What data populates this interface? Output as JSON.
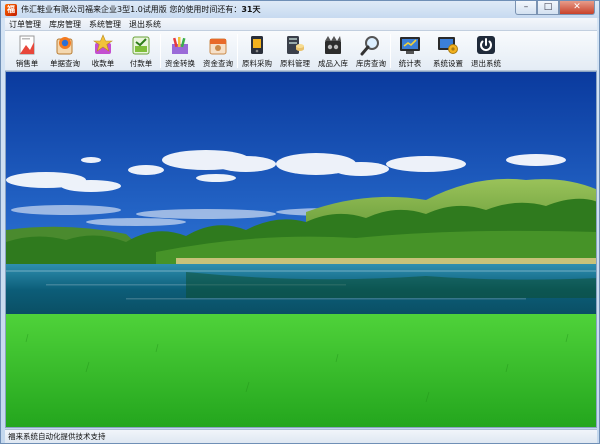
{
  "window": {
    "title": "伟汇鞋业有限公司福来企业3型1.0试用版  您的使用时间还有：",
    "days_left": "31天",
    "controls": {
      "minimize": "–",
      "maximize": "□",
      "close": "✕"
    }
  },
  "menu": [
    "订单管理",
    "库房管理",
    "系统管理",
    "退出系统"
  ],
  "toolbar": [
    {
      "label": "销售单",
      "icon": "sales-doc-icon"
    },
    {
      "label": "单据查询",
      "icon": "doc-search-icon"
    },
    {
      "label": "收款单",
      "icon": "receipt-icon"
    },
    {
      "label": "付款单",
      "icon": "payment-icon"
    },
    {
      "label": "资金转换",
      "icon": "fund-transfer-icon"
    },
    {
      "label": "资金查询",
      "icon": "fund-query-icon"
    },
    {
      "label": "原料采购",
      "icon": "material-purchase-icon"
    },
    {
      "label": "原料管理",
      "icon": "material-manage-icon"
    },
    {
      "label": "成品入库",
      "icon": "product-stock-icon"
    },
    {
      "label": "库房查询",
      "icon": "magnifier-icon"
    },
    {
      "label": "统计表",
      "icon": "stats-icon"
    },
    {
      "label": "系统设置",
      "icon": "settings-icon"
    },
    {
      "label": "退出系统",
      "icon": "power-icon"
    }
  ],
  "status": {
    "text": "福来系统自动化提供技术支持"
  },
  "colors": {
    "sky_top": "#0b3fa8",
    "sky_bottom": "#5aa8e8",
    "grass": "#33c02a",
    "lake": "#0a5a78"
  }
}
